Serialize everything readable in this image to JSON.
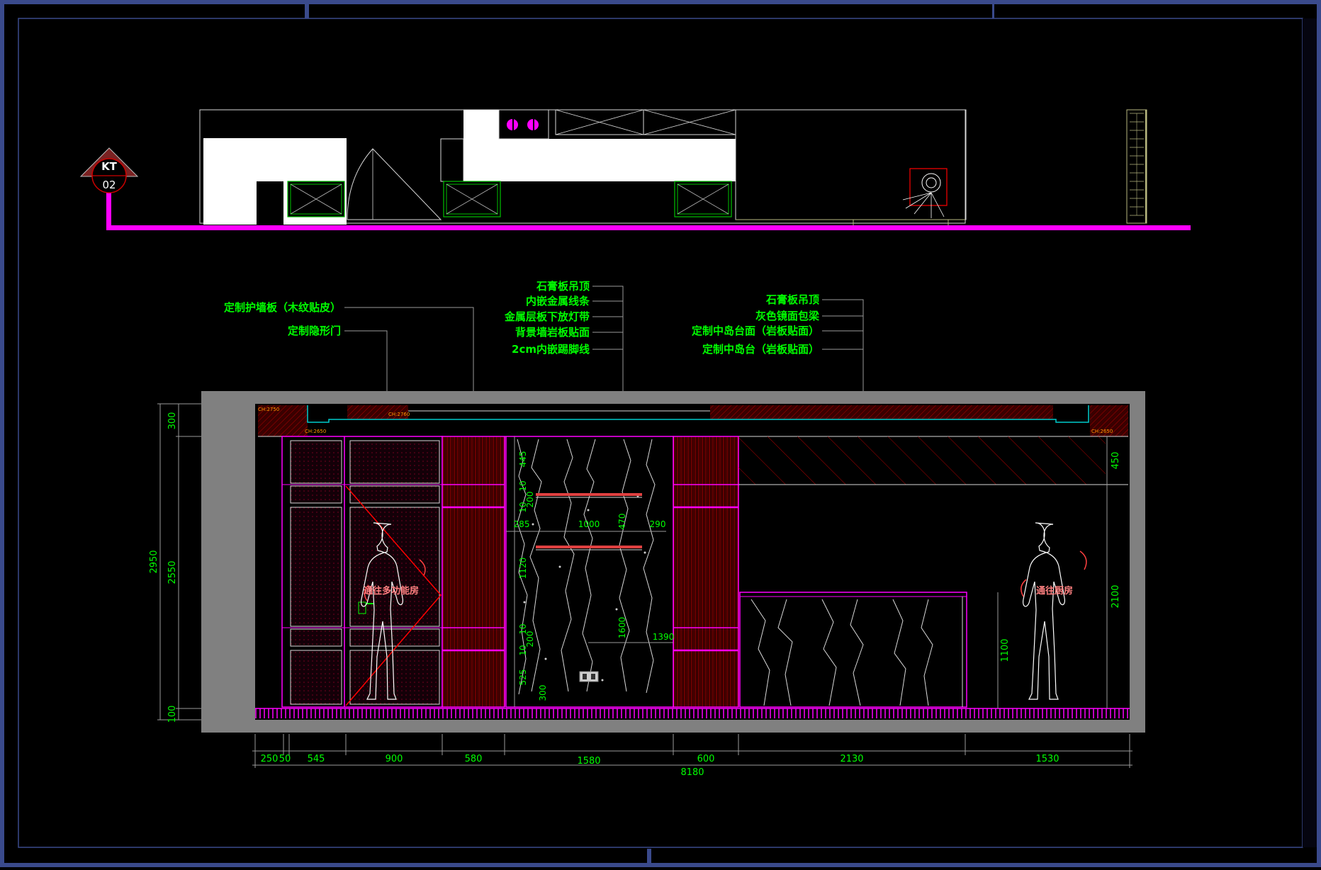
{
  "section_marker": {
    "line1": "KT",
    "line2": "02"
  },
  "left_labels": [
    "定制护墙板（木纹贴皮）",
    "定制隐形门"
  ],
  "center_labels": [
    "石膏板吊顶",
    "内嵌金属线条",
    "金属层板下放灯带",
    "背景墙岩板贴面",
    "2cm内嵌踢脚线"
  ],
  "right_labels": [
    "石膏板吊顶",
    "灰色镜面包梁",
    "定制中岛台面（岩板贴面）",
    "定制中岛台（岩板贴面）"
  ],
  "room_labels": {
    "multi": "通往多功能房",
    "kitchen": "通往厨房"
  },
  "bottom_dims": [
    "250",
    "50",
    "545",
    "900",
    "580",
    "1580",
    "600",
    "2130",
    "1530"
  ],
  "total_dim": "8180",
  "left_dims": {
    "d300": "300",
    "d2950": "2950",
    "d2550": "2550",
    "d100": "100"
  },
  "right_dims": {
    "d450": "450",
    "d2100": "2100",
    "d1100": "1100"
  },
  "inner_dims": {
    "a445": "445",
    "a10a": "10",
    "a10b": "10",
    "a200a": "200",
    "a285": "285",
    "a1000": "1000",
    "a470": "470",
    "a290": "290",
    "a1120": "1120",
    "a10c": "10",
    "a10d": "10",
    "a200b": "200",
    "a1600": "1600",
    "a1390": "1390",
    "a525": "525",
    "a300": "300"
  },
  "ceiling_tags": [
    "CH:2750",
    "CH:2650",
    "CH:2760",
    "CH:2650"
  ],
  "colors": {
    "background": "#000000",
    "frame": "#3a4a8c",
    "magenta": "#ff00ff",
    "green": "#00ff00",
    "label_red": "#ff8080",
    "wood": "#5a0000"
  }
}
